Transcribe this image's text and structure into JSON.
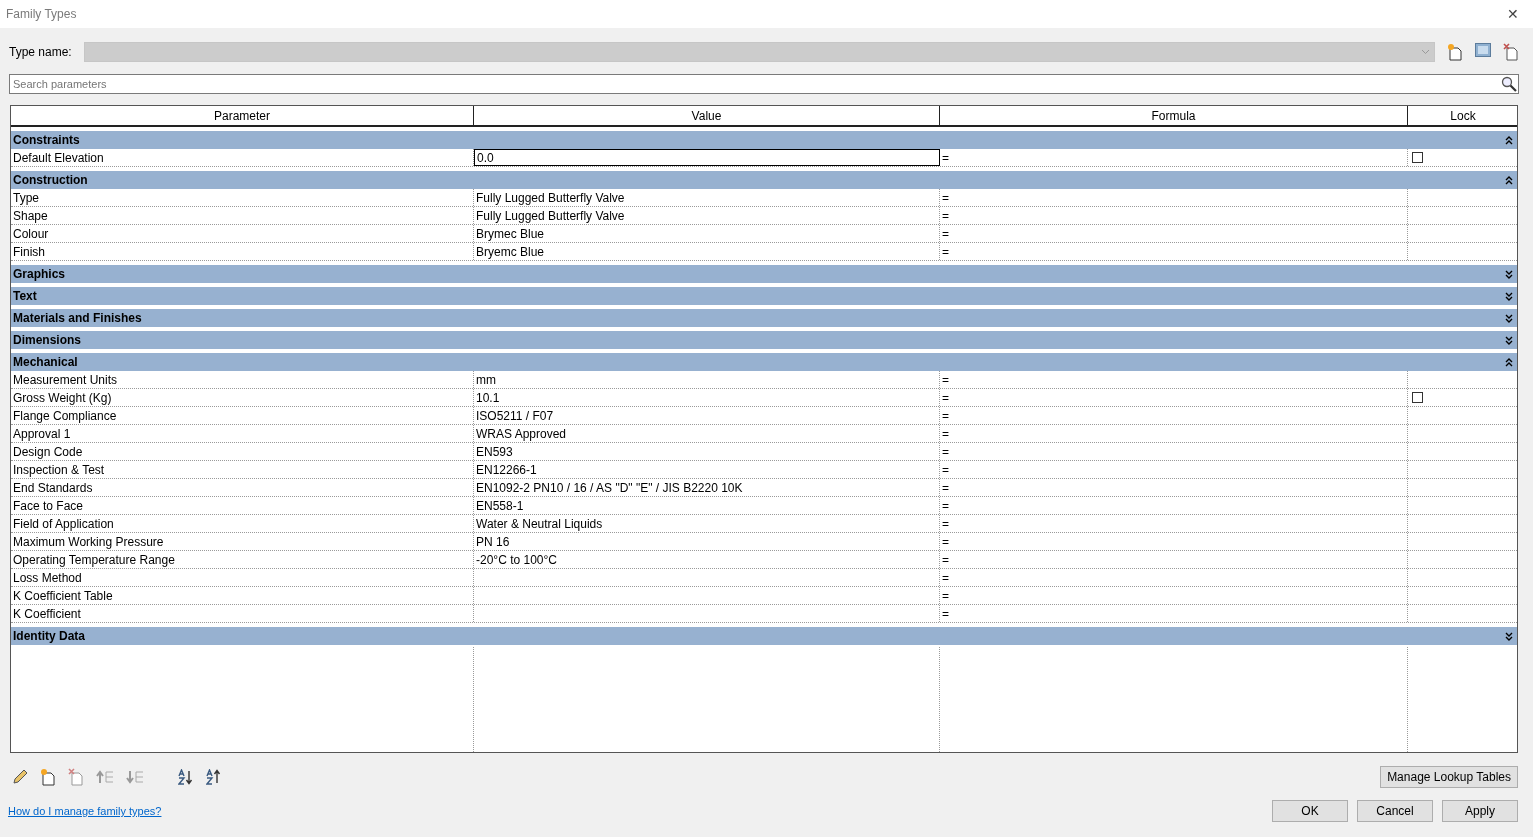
{
  "window": {
    "title": "Family Types",
    "close": "✕"
  },
  "type_name": {
    "label": "Type name:"
  },
  "search": {
    "placeholder": "Search parameters"
  },
  "table": {
    "columns": [
      "Parameter",
      "Value",
      "Formula",
      "Lock"
    ],
    "groups": [
      {
        "name": "Constraints",
        "expanded": true,
        "rows": [
          {
            "parameter": "Default Elevation",
            "value": "0.0",
            "formula": "=",
            "locked": false,
            "selected": true
          }
        ]
      },
      {
        "name": "Construction",
        "expanded": true,
        "rows": [
          {
            "parameter": "Type",
            "value": "Fully Lugged Butterfly Valve",
            "formula": "=",
            "selected": false
          },
          {
            "parameter": "Shape",
            "value": "Fully Lugged Butterfly Valve",
            "formula": "=",
            "selected": false
          },
          {
            "parameter": "Colour",
            "value": "Brymec Blue",
            "formula": "=",
            "selected": false
          },
          {
            "parameter": "Finish",
            "value": "Bryemc Blue",
            "formula": "=",
            "selected": false
          }
        ]
      },
      {
        "name": "Graphics",
        "expanded": false
      },
      {
        "name": "Text",
        "expanded": false
      },
      {
        "name": "Materials and Finishes",
        "expanded": false
      },
      {
        "name": "Dimensions",
        "expanded": false
      },
      {
        "name": "Mechanical",
        "expanded": true,
        "rows": [
          {
            "parameter": "Measurement Units",
            "value": "mm",
            "formula": "=",
            "selected": false
          },
          {
            "parameter": "Gross Weight (Kg)",
            "value": "10.1",
            "formula": "=",
            "locked": false,
            "selected": false
          },
          {
            "parameter": "Flange Compliance",
            "value": "ISO5211 / F07",
            "formula": "=",
            "selected": false
          },
          {
            "parameter": "Approval 1",
            "value": "WRAS Approved",
            "formula": "=",
            "selected": false
          },
          {
            "parameter": "Design Code",
            "value": "EN593",
            "formula": "=",
            "selected": false
          },
          {
            "parameter": "Inspection & Test",
            "value": "EN12266-1",
            "formula": "=",
            "selected": false
          },
          {
            "parameter": "End Standards",
            "value": "EN1092-2 PN10 / 16 / AS \"D\" \"E\" / JIS B2220 10K",
            "formula": "=",
            "selected": false
          },
          {
            "parameter": "Face to Face",
            "value": "EN558-1",
            "formula": "=",
            "selected": false
          },
          {
            "parameter": "Field of Application",
            "value": "Water & Neutral Liquids",
            "formula": "=",
            "selected": false
          },
          {
            "parameter": "Maximum Working Pressure",
            "value": "PN 16",
            "formula": "=",
            "selected": false
          },
          {
            "parameter": "Operating Temperature Range",
            "value": "-20°C to 100°C",
            "formula": "=",
            "selected": false
          },
          {
            "parameter": "Loss Method",
            "formula": "=",
            "selected": false
          },
          {
            "parameter": "K Coefficient Table",
            "formula": "=",
            "selected": false
          },
          {
            "parameter": "K Coefficient",
            "formula": "=",
            "selected": false
          }
        ]
      },
      {
        "name": "Identity Data",
        "expanded": false
      }
    ]
  },
  "buttons": {
    "manage_lookup": "Manage Lookup Tables",
    "ok": "OK",
    "cancel": "Cancel",
    "apply": "Apply"
  },
  "help_link": "How do I manage family types?"
}
